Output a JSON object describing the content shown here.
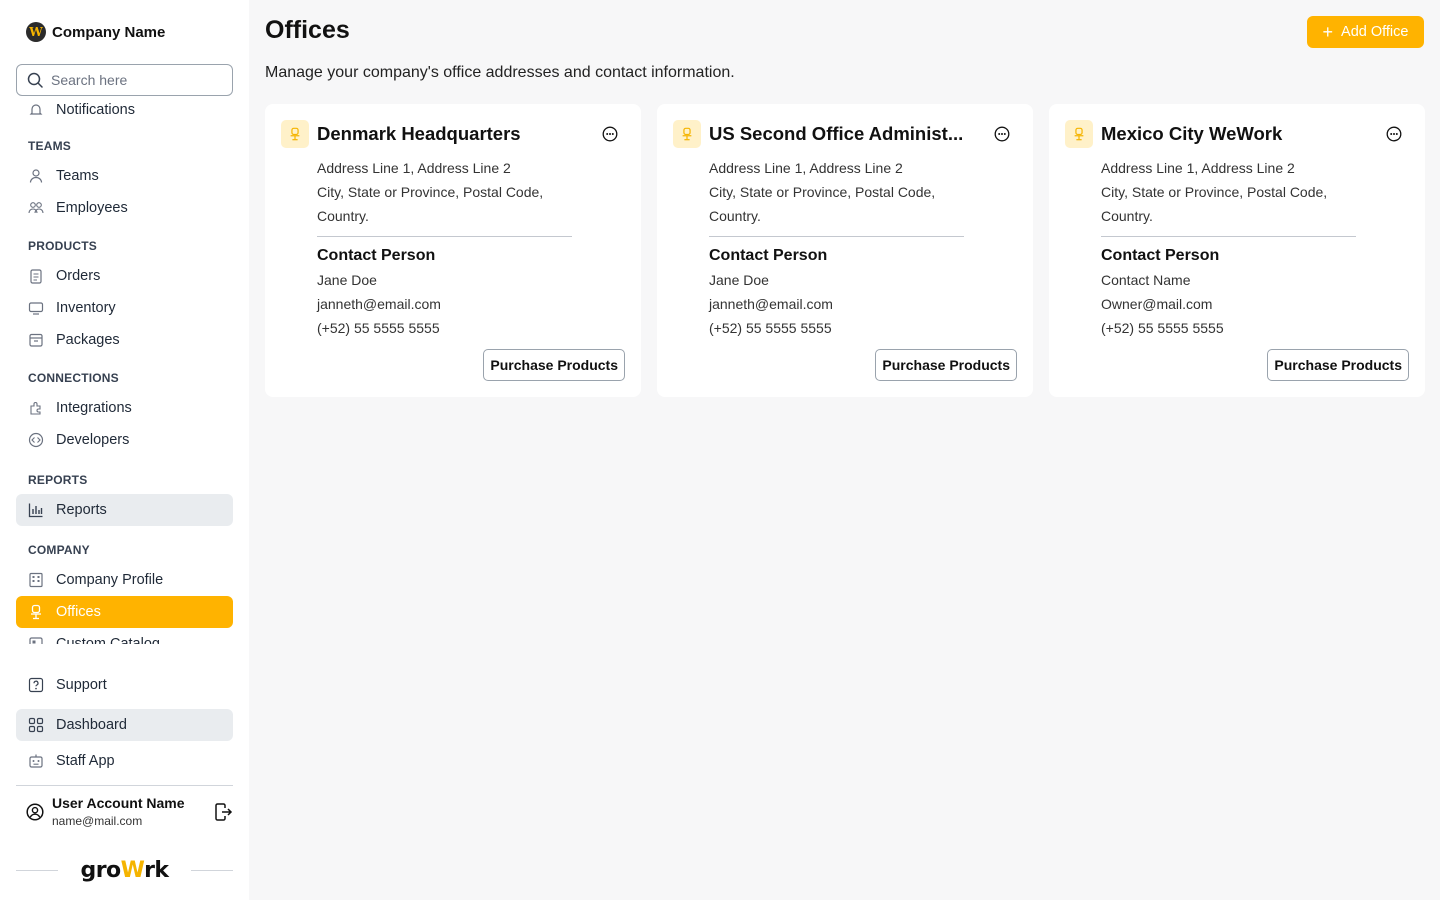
{
  "sidebar": {
    "brand": {
      "name": "Company Name",
      "logo_letter": "W"
    },
    "search": {
      "placeholder": "Search here"
    },
    "top_item": {
      "label": "Notifications",
      "icon": "bell-icon"
    },
    "sections": {
      "teams": {
        "title": "TEAMS",
        "items": [
          {
            "label": "Teams",
            "icon": "user-icon"
          },
          {
            "label": "Employees",
            "icon": "users-icon"
          }
        ]
      },
      "products": {
        "title": "PRODUCTS",
        "items": [
          {
            "label": "Orders",
            "icon": "clipboard-icon"
          },
          {
            "label": "Inventory",
            "icon": "monitor-icon"
          },
          {
            "label": "Packages",
            "icon": "package-icon"
          }
        ]
      },
      "connections": {
        "title": "CONNECTIONS",
        "items": [
          {
            "label": "Integrations",
            "icon": "puzzle-icon"
          },
          {
            "label": "Developers",
            "icon": "code-icon"
          }
        ]
      },
      "reports": {
        "title": "REPORTS",
        "items": [
          {
            "label": "Reports",
            "icon": "bar-chart-icon"
          }
        ]
      },
      "company": {
        "title": "COMPANY",
        "items": [
          {
            "label": "Company Profile",
            "icon": "building-icon"
          },
          {
            "label": "Offices",
            "icon": "office-chair-icon"
          },
          {
            "label": "Custom Catalog",
            "icon": "catalog-icon"
          }
        ]
      }
    },
    "bottom": {
      "support": "Support",
      "dashboard": "Dashboard",
      "staff_app": "Staff App"
    },
    "user": {
      "name": "User Account Name",
      "email": "name@mail.com"
    },
    "footer_logo": {
      "pre": "gro",
      "mid": "W",
      "post": "rk"
    }
  },
  "header": {
    "title": "Offices",
    "subtitle": "Manage your company's office addresses and contact information.",
    "add_button": "Add Office"
  },
  "offices": [
    {
      "name": "Denmark Headquarters",
      "address_line": "Address Line 1, Address Line 2",
      "city_line": "City, State or Province, Postal Code,",
      "country_line": "Country.",
      "contact_title": "Contact Person",
      "contact_name": "Jane Doe",
      "contact_email": "janneth@email.com",
      "contact_phone": "(+52) 55 5555 5555",
      "button": "Purchase Products"
    },
    {
      "name": "US Second Office Administ...",
      "address_line": "Address Line 1, Address Line 2",
      "city_line": "City, State or Province, Postal Code,",
      "country_line": "Country.",
      "contact_title": "Contact Person",
      "contact_name": "Jane Doe",
      "contact_email": "janneth@email.com",
      "contact_phone": "(+52) 55 5555 5555",
      "button": "Purchase Products"
    },
    {
      "name": "Mexico City WeWork",
      "address_line": "Address Line 1, Address Line 2",
      "city_line": "City, State or Province, Postal Code,",
      "country_line": "Country.",
      "contact_title": "Contact Person",
      "contact_name": "Contact Name",
      "contact_email": "Owner@mail.com",
      "contact_phone": "(+52) 55 5555 5555",
      "button": "Purchase Products"
    }
  ],
  "colors": {
    "accent": "#ffb300",
    "badge_bg": "#fff1c9",
    "page_bg": "#f7f7f8"
  }
}
